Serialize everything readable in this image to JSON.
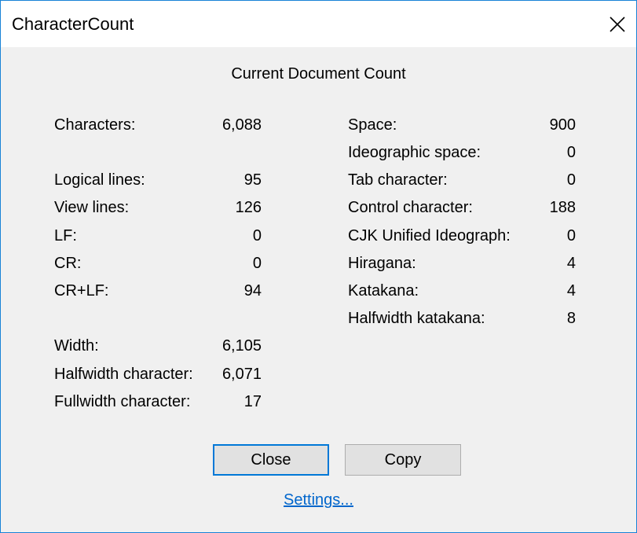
{
  "window": {
    "title": "CharacterCount"
  },
  "heading": "Current Document Count",
  "left_stats": [
    {
      "label": "Characters:",
      "value": "6,088"
    },
    {
      "label": "Logical lines:",
      "value": "95"
    },
    {
      "label": "View lines:",
      "value": "126"
    },
    {
      "label": "LF:",
      "value": "0"
    },
    {
      "label": "CR:",
      "value": "0"
    },
    {
      "label": "CR+LF:",
      "value": "94"
    },
    {
      "label": "Width:",
      "value": "6,105"
    },
    {
      "label": "Halfwidth character:",
      "value": "6,071"
    },
    {
      "label": "Fullwidth character:",
      "value": "17"
    }
  ],
  "right_stats": [
    {
      "label": "Space:",
      "value": "900"
    },
    {
      "label": "Ideographic space:",
      "value": "0"
    },
    {
      "label": "Tab character:",
      "value": "0"
    },
    {
      "label": "Control character:",
      "value": "188"
    },
    {
      "label": "CJK Unified Ideograph:",
      "value": "0"
    },
    {
      "label": "Hiragana:",
      "value": "4"
    },
    {
      "label": "Katakana:",
      "value": "4"
    },
    {
      "label": "Halfwidth katakana:",
      "value": "8"
    }
  ],
  "buttons": {
    "close_label": "Close",
    "copy_label": "Copy"
  },
  "settings_link": "Settings..."
}
